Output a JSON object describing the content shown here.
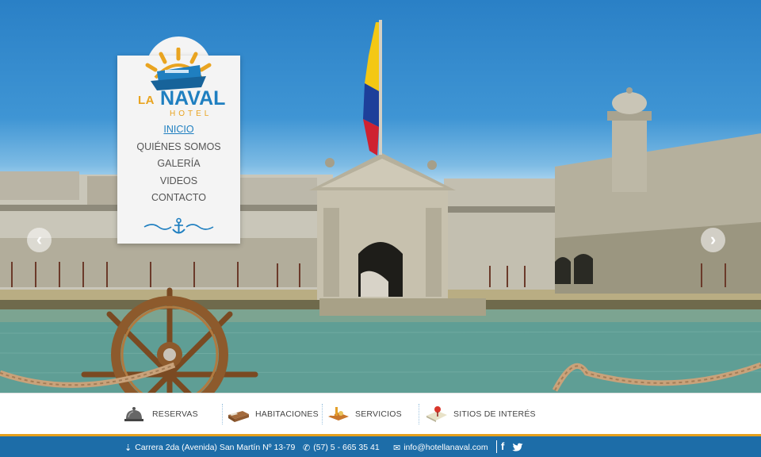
{
  "brand": {
    "la": "LA",
    "naval": "NAVAL",
    "hotel": "HOTEL"
  },
  "menu": {
    "items": [
      {
        "label": "INICIO",
        "active": true
      },
      {
        "label": "QUIÉNES SOMOS",
        "active": false
      },
      {
        "label": "GALERÍA",
        "active": false
      },
      {
        "label": "VIDEOS",
        "active": false
      },
      {
        "label": "CONTACTO",
        "active": false
      }
    ]
  },
  "slider": {
    "prev_icon": "chevron-left-icon",
    "next_icon": "chevron-right-icon"
  },
  "nav": {
    "items": [
      {
        "label": "RESERVAS",
        "icon": "service-bell-icon"
      },
      {
        "label": "HABITACIONES",
        "icon": "bed-icon"
      },
      {
        "label": "SERVICIOS",
        "icon": "room-service-tray-icon"
      },
      {
        "label": "SITIOS DE INTERÉS",
        "icon": "map-pin-icon"
      }
    ]
  },
  "footer": {
    "address": "Carrera 2da  (Avenida) San Martín Nº 13-79",
    "phone": "(57) 5 - 665 35 41",
    "email": "info@hotellanaval.com",
    "facebook": "f",
    "twitter": "t"
  },
  "colors": {
    "accent_blue": "#1f7fc0",
    "accent_gold": "#e5a01d",
    "footer_bg": "#1d6da8"
  }
}
